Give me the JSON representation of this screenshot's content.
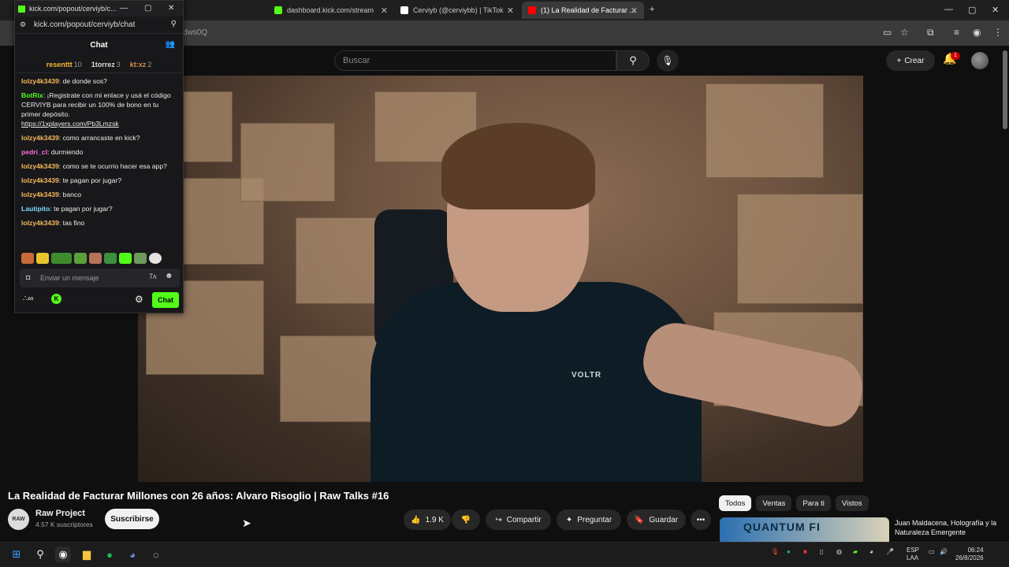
{
  "browser": {
    "tabs": [
      {
        "label": "kick.com/popout/cerviyb/c..."
      },
      {
        "label": "dashboard.kick.com/stream"
      },
      {
        "label": "Cerviyb (@cerviybb) | TikTok"
      },
      {
        "label": "(1) La Realidad de Facturar ..."
      }
    ],
    "url_fragment": "dws0Q",
    "colors": {
      "kick_green": "#53fc18",
      "youtube_red": "#ff0000"
    }
  },
  "kick": {
    "window_title": "kick.com/popout/cerviyb/c...",
    "url": "kick.com/popout/cerviyb/chat",
    "header": "Chat",
    "leaders": [
      {
        "name": "resenttt",
        "count": "10",
        "color": "#f5b82e"
      },
      {
        "name": "1torrez",
        "count": "3",
        "color": "#dcdcdc"
      },
      {
        "name": "kt:xz",
        "count": "2",
        "color": "#e08a45"
      }
    ],
    "messages": [
      {
        "user": "lolzy4k3439",
        "text": "de donde sos?",
        "color": "#f5b85a"
      },
      {
        "user": "BotRix",
        "text": "¡Registrate con mi enlace y usá el código CERVIYB para recibir un 100% de bono en tu primer depósito.",
        "link": "https://1xplayers.com/Pb3Lmzsk",
        "color": "#53fc18"
      },
      {
        "user": "lolzy4k3439",
        "text": "como arrancaste en kick?",
        "color": "#f5b85a"
      },
      {
        "user": "pedri_cl",
        "text": "durmiendo",
        "color": "#ff6fd8"
      },
      {
        "user": "lolzy4k3439",
        "text": "como se te ocurrio hacer esa app?",
        "color": "#f5b85a"
      },
      {
        "user": "lolzy4k3439",
        "text": "te pagan por jugar?",
        "color": "#f5b85a"
      },
      {
        "user": "lolzy4k3439",
        "text": "banco",
        "color": "#f5b85a"
      },
      {
        "user": "Lautipito",
        "text": "te pagan por jugar?",
        "color": "#7fd9ff"
      },
      {
        "user": "lolzy4k3439",
        "text": "tas fino",
        "color": "#f5b85a"
      }
    ],
    "input_placeholder": "Enviar un mensaje",
    "send_label": "Chat"
  },
  "youtube": {
    "search_placeholder": "Buscar",
    "create_label": "Crear",
    "notifications_count": "1",
    "video_title": "La Realidad de Facturar Millones con 26 años: Alvaro Risoglio | Raw Talks #16",
    "channel": {
      "avatar_text": "RAW",
      "name": "Raw Project",
      "subscribers": "4.57 K suscriptores"
    },
    "subscribe_label": "Suscribirse",
    "likes": "1.9 K",
    "share_label": "Compartir",
    "ask_label": "Preguntar",
    "save_label": "Guardar",
    "chips": [
      "Todos",
      "Ventas",
      "Para ti",
      "Vistos"
    ],
    "recommended": {
      "thumb_text": "QUANTUM FI",
      "title": "Juan Maldacena, Holografía y la Naturaleza Emergente"
    },
    "video_overlay_text": "VOLTR"
  },
  "taskbar": {
    "lang": "ESP",
    "layout": "LAA",
    "time": "06:24",
    "date": "26/8/2026"
  }
}
